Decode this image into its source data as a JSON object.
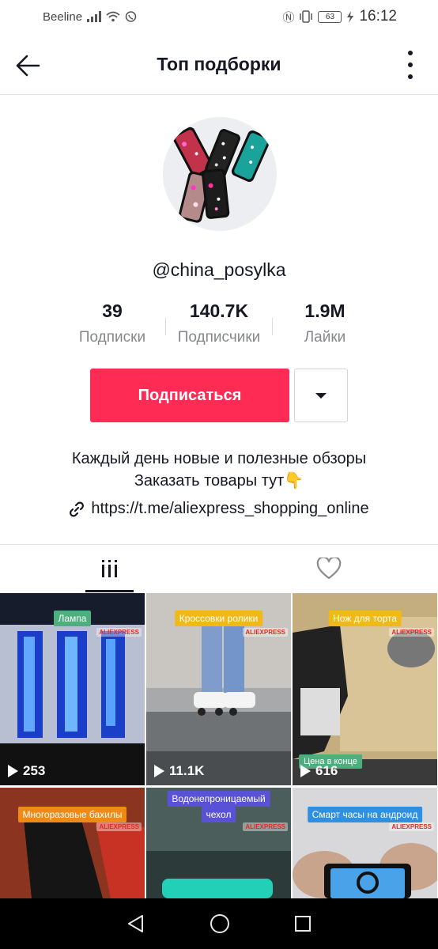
{
  "status_bar": {
    "carrier": "Beeline",
    "battery": "63",
    "time": "16:12",
    "icons": [
      "signal-icon",
      "wifi-icon",
      "viber-icon",
      "nfc-icon",
      "vibrate-icon",
      "battery-icon",
      "charging-icon"
    ]
  },
  "header": {
    "title": "Топ подборки",
    "back_icon": "arrow-left-icon",
    "more_icon": "more-vertical-icon"
  },
  "profile": {
    "username": "@china_posylka",
    "avatar_icon": "avatar-phone-cases",
    "stats": [
      {
        "value": "39",
        "label": "Подписки"
      },
      {
        "value": "140.7K",
        "label": "Подписчики"
      },
      {
        "value": "1.9M",
        "label": "Лайки"
      }
    ],
    "follow_label": "Подписаться",
    "dropdown_icon": "caret-down-icon",
    "bio_line1": "Каждый день новые и полезные обзоры",
    "bio_line2": "Заказать товары тут👇",
    "link": "https://t.me/aliexpress_shopping_online",
    "link_icon": "link-icon"
  },
  "tabs": [
    {
      "name": "videos",
      "icon": "grid-icon",
      "active": true
    },
    {
      "name": "liked",
      "icon": "heart-icon",
      "active": false
    }
  ],
  "videos": [
    {
      "tag": "Лампа",
      "tag_color": "#4caf7d",
      "views": "253",
      "logo": "ALIEXPRESS"
    },
    {
      "tag": "Кроссовки ролики",
      "tag_color": "#f0b917",
      "views": "11.1K",
      "logo": "ALIEXPRESS"
    },
    {
      "tag": "Нож для торта",
      "tag_color": "#f0b917",
      "views": "616",
      "logo": "ALIEXPRESS",
      "tag2": "Цена в конце"
    },
    {
      "tag": "Многоразовые бахилы",
      "tag_color": "#f08a17",
      "logo": "ALIEXPRESS"
    },
    {
      "tag": "Водонепроницаемый",
      "tag_line2": "чехол",
      "tag_color": "#5a52d6",
      "logo": "ALIEXPRESS"
    },
    {
      "tag": "Смарт часы на андроид",
      "tag_color": "#2f8fe0",
      "logo": "ALIEXPRESS"
    }
  ],
  "navbar": {
    "icons": [
      "back-triangle-icon",
      "home-circle-icon",
      "recents-square-icon"
    ]
  },
  "colors": {
    "accent": "#fe2c55",
    "text": "#161823",
    "muted": "#86878b"
  }
}
